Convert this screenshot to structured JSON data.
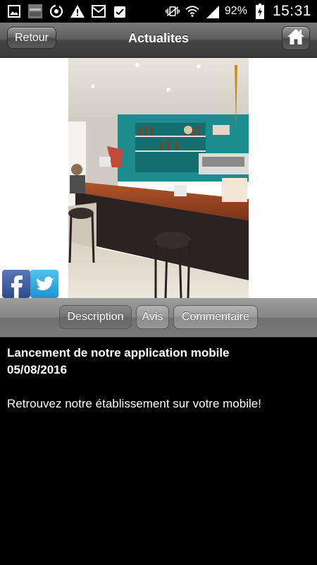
{
  "status_bar": {
    "battery": "92%",
    "time": "15:31",
    "icons": [
      "gallery-icon",
      "app-thumbnail-icon",
      "sync-icon",
      "warning-icon",
      "mail-icon",
      "clipboard-check-icon",
      "vibrate-icon",
      "wifi-icon",
      "signal-icon",
      "battery-charging-icon"
    ]
  },
  "header": {
    "back_label": "Retour",
    "title": "Actualites",
    "home_icon": "home-icon"
  },
  "image": {
    "description_icons": [
      "facebook-icon",
      "twitter-icon"
    ],
    "facebook_label": "f"
  },
  "tabs": [
    {
      "label": "Description",
      "active": true
    },
    {
      "label": "Avis",
      "active": false
    },
    {
      "label": "Commentaire",
      "active": false
    }
  ],
  "article": {
    "title": "Lancement de notre application mobile",
    "date": "05/08/2016",
    "body": "Retrouvez notre établissement sur votre mobile!"
  },
  "colors": {
    "header_gradient_top": "#7a7a7a",
    "header_gradient_bottom": "#3a3a3a",
    "content_bg": "#000000",
    "text": "#ffffff"
  }
}
